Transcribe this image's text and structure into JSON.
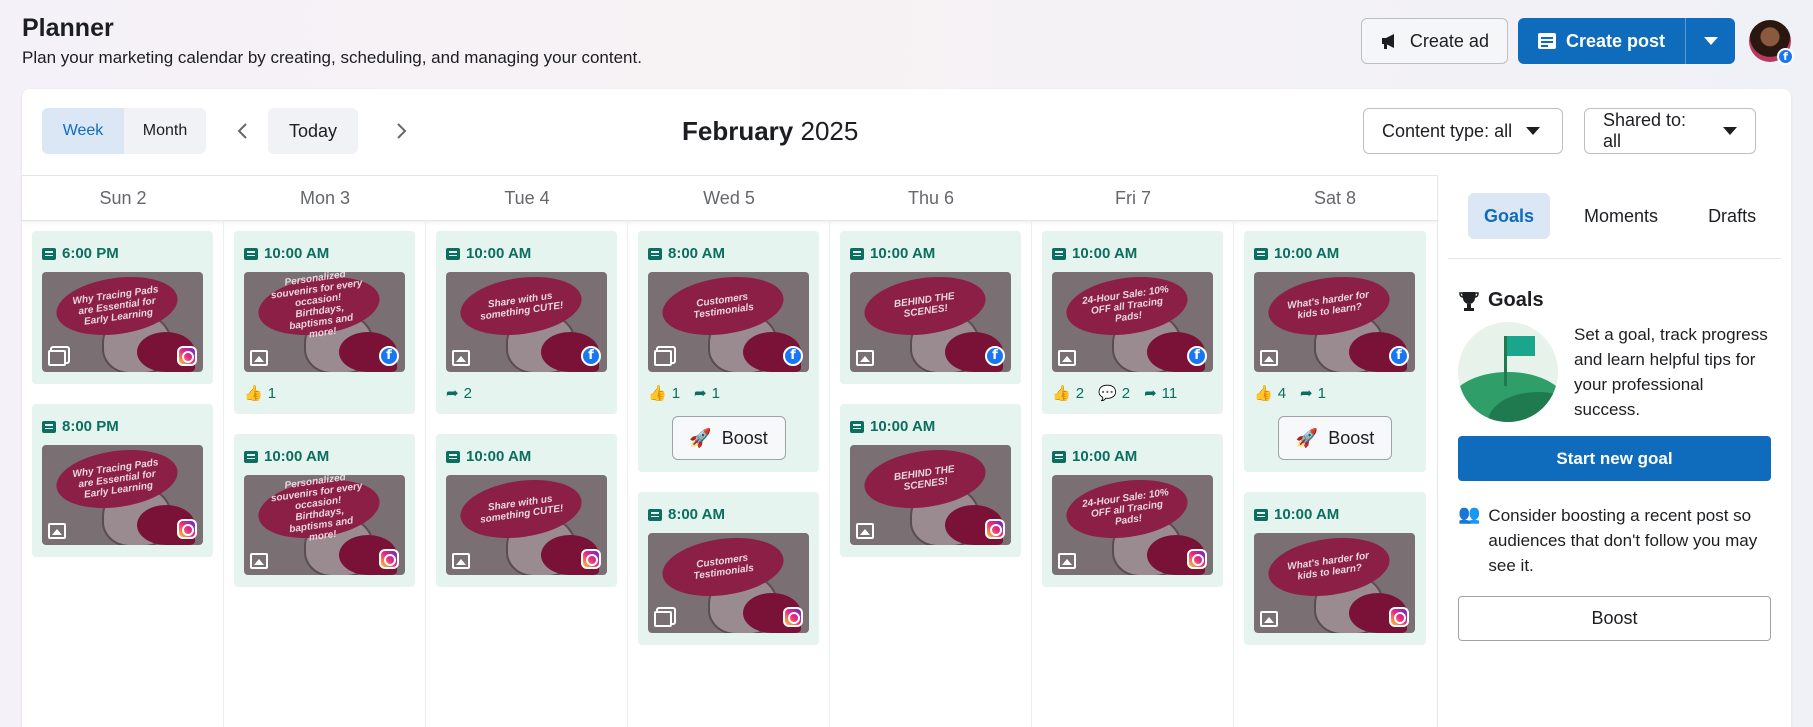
{
  "header": {
    "title": "Planner",
    "subtitle": "Plan your marketing calendar by creating, scheduling, and managing your content."
  },
  "actions": {
    "create_ad": "Create ad",
    "create_post": "Create post",
    "create_ad_icon": "megaphone-icon",
    "create_post_icon": "post-icon"
  },
  "toolbar": {
    "view_week": "Week",
    "view_month": "Month",
    "active_view": "Week",
    "today": "Today",
    "month_name": "February",
    "year": "2025",
    "content_filter": "Content type: all",
    "shared_filter": "Shared to: all"
  },
  "colors": {
    "primary": "#0f6cbd",
    "card_bg": "#e5f4ee",
    "time_text": "#0b6e5f",
    "facebook": "#1877f2"
  },
  "days": [
    {
      "label": "Sun 2",
      "posts": [
        {
          "time": "6:00 PM",
          "caption": "Why Tracing Pads are Essential for Early Learning",
          "media": "stack",
          "network": "instagram",
          "metrics": [],
          "boost": false
        },
        {
          "time": "8:00 PM",
          "caption": "Why Tracing Pads are Essential for Early Learning",
          "media": "image",
          "network": "instagram",
          "metrics": [],
          "boost": false
        }
      ]
    },
    {
      "label": "Mon 3",
      "posts": [
        {
          "time": "10:00 AM",
          "caption": "Personalized souvenirs for every occasion! Birthdays, baptisms and more!",
          "media": "image",
          "network": "facebook",
          "metrics": [
            {
              "icon": "like-icon",
              "value": "1"
            }
          ],
          "boost": false
        },
        {
          "time": "10:00 AM",
          "caption": "Personalized souvenirs for every occasion! Birthdays, baptisms and more!",
          "media": "image",
          "network": "instagram",
          "metrics": [],
          "boost": false
        }
      ]
    },
    {
      "label": "Tue 4",
      "posts": [
        {
          "time": "10:00 AM",
          "caption": "Share with us something CUTE!",
          "media": "image",
          "network": "facebook",
          "metrics": [
            {
              "icon": "share-icon",
              "value": "2"
            }
          ],
          "boost": false
        },
        {
          "time": "10:00 AM",
          "caption": "Share with us something CUTE!",
          "media": "image",
          "network": "instagram",
          "metrics": [],
          "boost": false
        }
      ]
    },
    {
      "label": "Wed 5",
      "posts": [
        {
          "time": "8:00 AM",
          "caption": "Customers Testimonials",
          "media": "stack",
          "network": "facebook",
          "metrics": [
            {
              "icon": "like-icon",
              "value": "1"
            },
            {
              "icon": "share-icon",
              "value": "1"
            }
          ],
          "boost": true
        },
        {
          "time": "8:00 AM",
          "caption": "Customers Testimonials",
          "media": "stack",
          "network": "instagram",
          "metrics": [],
          "boost": false
        }
      ]
    },
    {
      "label": "Thu 6",
      "posts": [
        {
          "time": "10:00 AM",
          "caption": "BEHIND THE SCENES!",
          "media": "image",
          "network": "facebook",
          "metrics": [],
          "boost": false
        },
        {
          "time": "10:00 AM",
          "caption": "BEHIND THE SCENES!",
          "media": "image",
          "network": "instagram",
          "metrics": [],
          "boost": false
        }
      ]
    },
    {
      "label": "Fri 7",
      "posts": [
        {
          "time": "10:00 AM",
          "caption": "24-Hour Sale: 10% OFF all Tracing Pads!",
          "media": "image",
          "network": "facebook",
          "metrics": [
            {
              "icon": "like-icon",
              "value": "2"
            },
            {
              "icon": "comment-icon",
              "value": "2"
            },
            {
              "icon": "share-icon",
              "value": "11"
            }
          ],
          "boost": false
        },
        {
          "time": "10:00 AM",
          "caption": "24-Hour Sale: 10% OFF all Tracing Pads!",
          "media": "image",
          "network": "instagram",
          "metrics": [],
          "boost": false
        }
      ]
    },
    {
      "label": "Sat 8",
      "posts": [
        {
          "time": "10:00 AM",
          "caption": "What's harder for kids to learn?",
          "media": "image",
          "network": "facebook",
          "metrics": [
            {
              "icon": "like-icon",
              "value": "4"
            },
            {
              "icon": "share-icon",
              "value": "1"
            }
          ],
          "boost": true
        },
        {
          "time": "10:00 AM",
          "caption": "What's harder for kids to learn?",
          "media": "image",
          "network": "instagram",
          "metrics": [],
          "boost": false
        }
      ]
    }
  ],
  "boost_label": "Boost",
  "side_panel": {
    "tabs": [
      "Goals",
      "Moments",
      "Drafts"
    ],
    "active_tab": "Goals",
    "goals_title": "Goals",
    "goals_text": "Set a goal, track progress and learn helpful tips for your professional success.",
    "start_goal": "Start new goal",
    "boost_tip": "Consider boosting a recent post so audiences that don't follow you may see it.",
    "boost_button": "Boost"
  }
}
